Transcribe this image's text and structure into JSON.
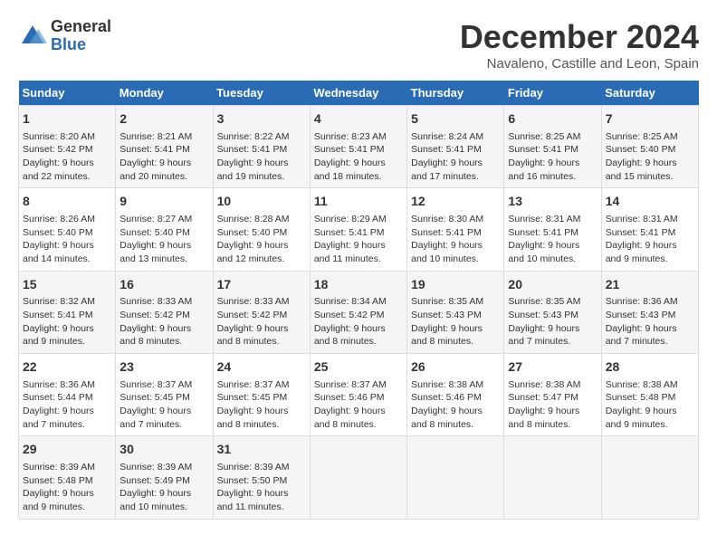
{
  "header": {
    "logo_general": "General",
    "logo_blue": "Blue",
    "month_title": "December 2024",
    "location": "Navaleno, Castille and Leon, Spain"
  },
  "days_of_week": [
    "Sunday",
    "Monday",
    "Tuesday",
    "Wednesday",
    "Thursday",
    "Friday",
    "Saturday"
  ],
  "weeks": [
    [
      {
        "day": "1",
        "sunrise": "Sunrise: 8:20 AM",
        "sunset": "Sunset: 5:42 PM",
        "daylight": "Daylight: 9 hours and 22 minutes."
      },
      {
        "day": "2",
        "sunrise": "Sunrise: 8:21 AM",
        "sunset": "Sunset: 5:41 PM",
        "daylight": "Daylight: 9 hours and 20 minutes."
      },
      {
        "day": "3",
        "sunrise": "Sunrise: 8:22 AM",
        "sunset": "Sunset: 5:41 PM",
        "daylight": "Daylight: 9 hours and 19 minutes."
      },
      {
        "day": "4",
        "sunrise": "Sunrise: 8:23 AM",
        "sunset": "Sunset: 5:41 PM",
        "daylight": "Daylight: 9 hours and 18 minutes."
      },
      {
        "day": "5",
        "sunrise": "Sunrise: 8:24 AM",
        "sunset": "Sunset: 5:41 PM",
        "daylight": "Daylight: 9 hours and 17 minutes."
      },
      {
        "day": "6",
        "sunrise": "Sunrise: 8:25 AM",
        "sunset": "Sunset: 5:41 PM",
        "daylight": "Daylight: 9 hours and 16 minutes."
      },
      {
        "day": "7",
        "sunrise": "Sunrise: 8:25 AM",
        "sunset": "Sunset: 5:40 PM",
        "daylight": "Daylight: 9 hours and 15 minutes."
      }
    ],
    [
      {
        "day": "8",
        "sunrise": "Sunrise: 8:26 AM",
        "sunset": "Sunset: 5:40 PM",
        "daylight": "Daylight: 9 hours and 14 minutes."
      },
      {
        "day": "9",
        "sunrise": "Sunrise: 8:27 AM",
        "sunset": "Sunset: 5:40 PM",
        "daylight": "Daylight: 9 hours and 13 minutes."
      },
      {
        "day": "10",
        "sunrise": "Sunrise: 8:28 AM",
        "sunset": "Sunset: 5:40 PM",
        "daylight": "Daylight: 9 hours and 12 minutes."
      },
      {
        "day": "11",
        "sunrise": "Sunrise: 8:29 AM",
        "sunset": "Sunset: 5:41 PM",
        "daylight": "Daylight: 9 hours and 11 minutes."
      },
      {
        "day": "12",
        "sunrise": "Sunrise: 8:30 AM",
        "sunset": "Sunset: 5:41 PM",
        "daylight": "Daylight: 9 hours and 10 minutes."
      },
      {
        "day": "13",
        "sunrise": "Sunrise: 8:31 AM",
        "sunset": "Sunset: 5:41 PM",
        "daylight": "Daylight: 9 hours and 10 minutes."
      },
      {
        "day": "14",
        "sunrise": "Sunrise: 8:31 AM",
        "sunset": "Sunset: 5:41 PM",
        "daylight": "Daylight: 9 hours and 9 minutes."
      }
    ],
    [
      {
        "day": "15",
        "sunrise": "Sunrise: 8:32 AM",
        "sunset": "Sunset: 5:41 PM",
        "daylight": "Daylight: 9 hours and 9 minutes."
      },
      {
        "day": "16",
        "sunrise": "Sunrise: 8:33 AM",
        "sunset": "Sunset: 5:42 PM",
        "daylight": "Daylight: 9 hours and 8 minutes."
      },
      {
        "day": "17",
        "sunrise": "Sunrise: 8:33 AM",
        "sunset": "Sunset: 5:42 PM",
        "daylight": "Daylight: 9 hours and 8 minutes."
      },
      {
        "day": "18",
        "sunrise": "Sunrise: 8:34 AM",
        "sunset": "Sunset: 5:42 PM",
        "daylight": "Daylight: 9 hours and 8 minutes."
      },
      {
        "day": "19",
        "sunrise": "Sunrise: 8:35 AM",
        "sunset": "Sunset: 5:43 PM",
        "daylight": "Daylight: 9 hours and 8 minutes."
      },
      {
        "day": "20",
        "sunrise": "Sunrise: 8:35 AM",
        "sunset": "Sunset: 5:43 PM",
        "daylight": "Daylight: 9 hours and 7 minutes."
      },
      {
        "day": "21",
        "sunrise": "Sunrise: 8:36 AM",
        "sunset": "Sunset: 5:43 PM",
        "daylight": "Daylight: 9 hours and 7 minutes."
      }
    ],
    [
      {
        "day": "22",
        "sunrise": "Sunrise: 8:36 AM",
        "sunset": "Sunset: 5:44 PM",
        "daylight": "Daylight: 9 hours and 7 minutes."
      },
      {
        "day": "23",
        "sunrise": "Sunrise: 8:37 AM",
        "sunset": "Sunset: 5:45 PM",
        "daylight": "Daylight: 9 hours and 7 minutes."
      },
      {
        "day": "24",
        "sunrise": "Sunrise: 8:37 AM",
        "sunset": "Sunset: 5:45 PM",
        "daylight": "Daylight: 9 hours and 8 minutes."
      },
      {
        "day": "25",
        "sunrise": "Sunrise: 8:37 AM",
        "sunset": "Sunset: 5:46 PM",
        "daylight": "Daylight: 9 hours and 8 minutes."
      },
      {
        "day": "26",
        "sunrise": "Sunrise: 8:38 AM",
        "sunset": "Sunset: 5:46 PM",
        "daylight": "Daylight: 9 hours and 8 minutes."
      },
      {
        "day": "27",
        "sunrise": "Sunrise: 8:38 AM",
        "sunset": "Sunset: 5:47 PM",
        "daylight": "Daylight: 9 hours and 8 minutes."
      },
      {
        "day": "28",
        "sunrise": "Sunrise: 8:38 AM",
        "sunset": "Sunset: 5:48 PM",
        "daylight": "Daylight: 9 hours and 9 minutes."
      }
    ],
    [
      {
        "day": "29",
        "sunrise": "Sunrise: 8:39 AM",
        "sunset": "Sunset: 5:48 PM",
        "daylight": "Daylight: 9 hours and 9 minutes."
      },
      {
        "day": "30",
        "sunrise": "Sunrise: 8:39 AM",
        "sunset": "Sunset: 5:49 PM",
        "daylight": "Daylight: 9 hours and 10 minutes."
      },
      {
        "day": "31",
        "sunrise": "Sunrise: 8:39 AM",
        "sunset": "Sunset: 5:50 PM",
        "daylight": "Daylight: 9 hours and 11 minutes."
      },
      null,
      null,
      null,
      null
    ]
  ]
}
